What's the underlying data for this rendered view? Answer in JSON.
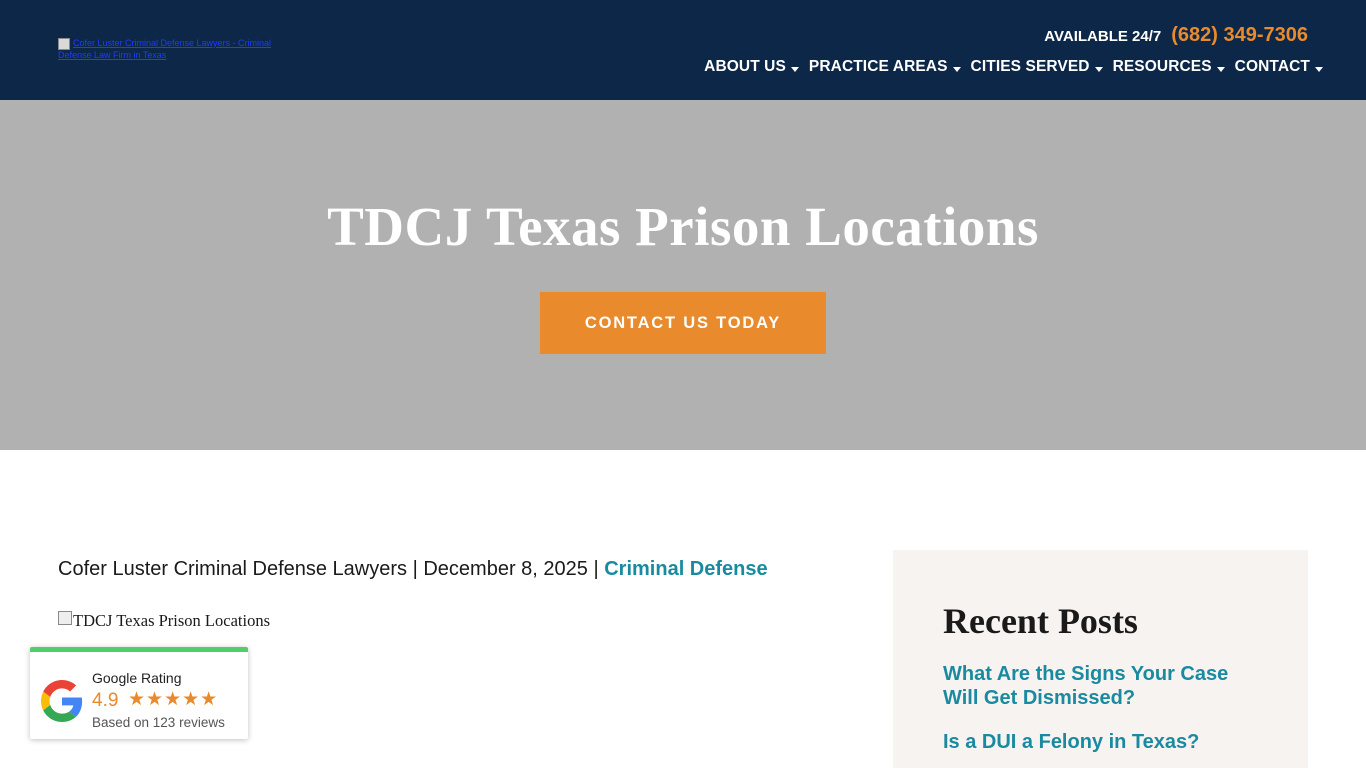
{
  "header": {
    "logo_alt": "Cofer Luster Criminal Defense Lawyers - Criminal Defense Law Firm in Texas",
    "available_label": "AVAILABLE 24/7",
    "phone": "(682) 349-7306",
    "nav": [
      {
        "label": "ABOUT US"
      },
      {
        "label": "PRACTICE AREAS"
      },
      {
        "label": "CITIES SERVED"
      },
      {
        "label": "RESOURCES"
      },
      {
        "label": "CONTACT"
      }
    ]
  },
  "hero": {
    "title": "TDCJ Texas Prison Locations",
    "cta_label": "CONTACT US TODAY"
  },
  "post": {
    "author": "Cofer Luster Criminal Defense Lawyers",
    "date": "December 8, 2025",
    "separator": "|",
    "category": "Criminal Defense",
    "image_alt": "TDCJ Texas Prison Locations"
  },
  "sidebar": {
    "title": "Recent Posts",
    "posts": [
      {
        "label": "What Are the Signs Your Case Will Get Dismissed?"
      },
      {
        "label": "Is a DUI a Felony in Texas?"
      }
    ]
  },
  "google_rating": {
    "title": "Google Rating",
    "score": "4.9",
    "stars": "★★★★★",
    "based_on": "Based on 123 reviews"
  },
  "colors": {
    "header_bg": "#0c2748",
    "accent_orange": "#e98a2c",
    "link_teal": "#1a8aa0",
    "hero_bg": "#b1b1b1",
    "sidebar_bg": "#f7f3f1",
    "rating_bar": "#4fce6a"
  },
  "icons": [
    "caret-down-icon",
    "google-g-icon",
    "star-icon",
    "broken-image-icon"
  ]
}
